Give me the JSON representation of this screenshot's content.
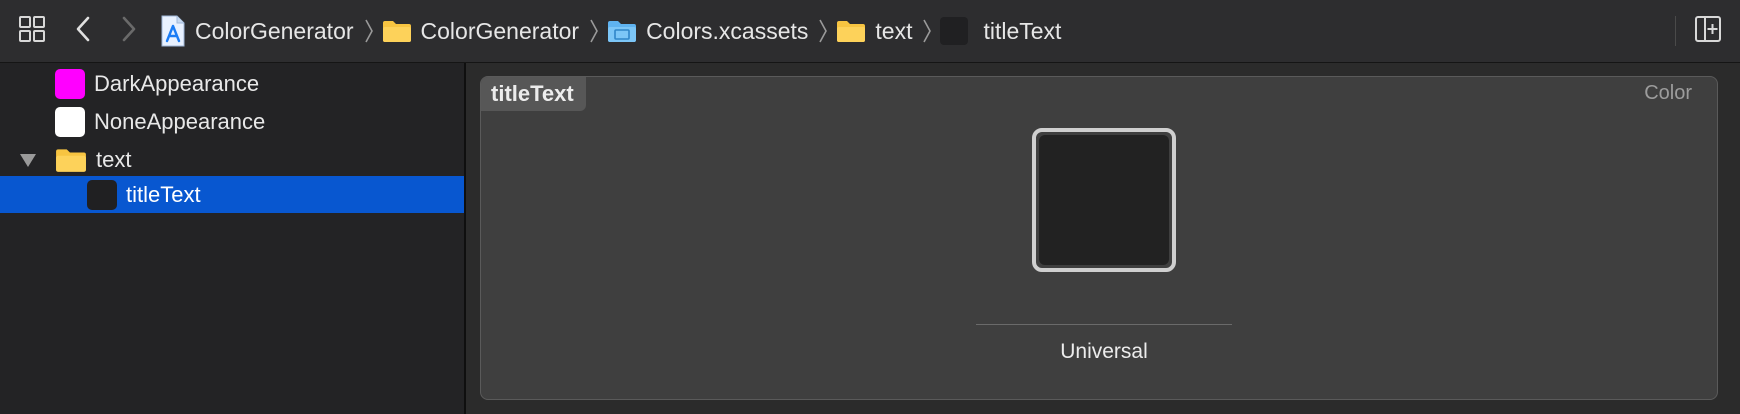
{
  "jump_bar": {
    "grid_icon": "related-items-grid-icon",
    "back_icon": "chevron-left-icon",
    "forward_icon": "chevron-right-icon",
    "crumbs": [
      {
        "label": "ColorGenerator",
        "icon": "project-file-icon"
      },
      {
        "label": "ColorGenerator",
        "icon": "folder-icon"
      },
      {
        "label": "Colors.xcassets",
        "icon": "asset-catalog-icon"
      },
      {
        "label": "text",
        "icon": "folder-icon"
      },
      {
        "label": "titleText",
        "icon": "color-set-icon"
      }
    ],
    "add_editor_icon": "add-editor-icon"
  },
  "navigator": {
    "items": [
      {
        "label": "DarkAppearance",
        "swatch": "#ff00ff"
      },
      {
        "label": "NoneAppearance",
        "swatch": "#ffffff"
      },
      {
        "label": "text",
        "icon": "folder-icon",
        "expanded": true
      },
      {
        "label": "titleText",
        "swatch": "#202022",
        "selected": true
      }
    ],
    "colors": {
      "selection": "#0857d0",
      "folder": "#f5c243"
    }
  },
  "editor": {
    "set_name": "titleText",
    "set_type": "Color",
    "wells": [
      {
        "label": "Universal",
        "color": "#222222"
      }
    ]
  }
}
